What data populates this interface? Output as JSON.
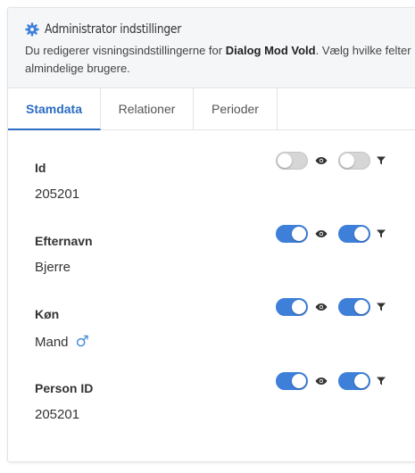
{
  "admin": {
    "title": "Administrator indstillinger",
    "desc_prefix": "Du redigerer visningsindstillingerne for ",
    "desc_bold": "Dialog Mod Vold",
    "desc_suffix": ". Vælg hvilke felter",
    "desc_line2": "almindelige brugere."
  },
  "tabs": [
    {
      "label": "Stamdata",
      "active": true
    },
    {
      "label": "Relationer",
      "active": false
    },
    {
      "label": "Perioder",
      "active": false
    }
  ],
  "fields": [
    {
      "label": "Id",
      "value": "205201",
      "visible": false,
      "filter": false
    },
    {
      "label": "Efternavn",
      "value": "Bjerre",
      "visible": true,
      "filter": true
    },
    {
      "label": "Køn",
      "value": "Mand",
      "icon": "male-icon",
      "visible": true,
      "filter": true
    },
    {
      "label": "Person ID",
      "value": "205201",
      "visible": true,
      "filter": true
    }
  ],
  "colors": {
    "accent": "#3d7fd9",
    "tab_active": "#2b6cc4",
    "toggle_off": "#d6d6d6"
  }
}
